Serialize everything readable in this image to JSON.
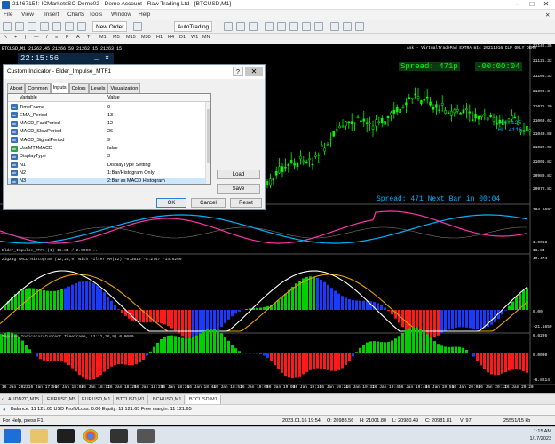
{
  "window": {
    "title": "21467154: ICMarketsSC-Demo02 - Demo Account - Raw Trading Ltd - [BTCUSD,M1]",
    "controls": [
      "–",
      "□",
      "✕"
    ]
  },
  "menu": [
    "File",
    "View",
    "Insert",
    "Charts",
    "Tools",
    "Window",
    "Help"
  ],
  "toolbar": {
    "new_order": "New Order",
    "autotrading": "AutoTrading",
    "timeframes": [
      "M1",
      "M5",
      "M15",
      "M30",
      "H1",
      "H4",
      "D1",
      "W1",
      "MN"
    ]
  },
  "chart": {
    "header": "BTCUSD,M1  21262.45 21266.59 21262.15 21263.15",
    "broker_label": "Ask - VirtualTradePad EXTRA mt4 20211016 CLP ONLY DEMO",
    "clock": "22:15:56",
    "spread_label": "Spread: 471p",
    "timer_label": "-00:00:04",
    "oc_label": "OC 125",
    "hl_label": "HL 4116",
    "bottom_info": "Spread: 471 Next Bar in 00:04",
    "price_axis": [
      "21142.35",
      "21125.33",
      "21106.33",
      "21090.3",
      "21075.30",
      "21060.63",
      "21040.88",
      "21022.03",
      "21006.83",
      "20989.83",
      "20972.83"
    ],
    "impulse_axis": [
      "104.6697",
      "1.9063",
      "16.84"
    ],
    "macd_axis": [
      "40.474",
      "0.00",
      "-21.1659"
    ],
    "impulse2_axis": [
      "6.6205",
      "0.0000",
      "-6.8214"
    ],
    "sub_titles": {
      "sub1": "Elder_Impulse_MTF1 (1) 16.84 / 2.5000 ...",
      "sub2": "ZigZag MACD Histogram (12,26,9) With Filter MA(12) -6.3519 -8.2747 -14.6266",
      "sub3": "Impulse Indicator(Current Timeframe, 13:12,26,9) 0.0000"
    },
    "time_axis": [
      "16 Jan 2023",
      "16 Jan 17:56",
      "16 Jan 18:04",
      "16 Jan 18:12",
      "16 Jan 18:20",
      "16 Jan 18:28",
      "16 Jan 18:36",
      "16 Jan 18:44",
      "16 Jan 18:52",
      "16 Jan 19:00",
      "16 Jan 19:08",
      "16 Jan 19:16",
      "16 Jan 19:24",
      "16 Jan 19:32",
      "16 Jan 19:40",
      "16 Jan 19:48",
      "16 Jan 19:56",
      "16 Jan 20:04",
      "16 Jan 20:12",
      "16 Jan 20:20"
    ]
  },
  "dialog": {
    "title": "Custom Indicator - Elder_Impulse_MTF1",
    "help": "?",
    "close": "✕",
    "tabs": [
      "About",
      "Common",
      "Inputs",
      "Colors",
      "Levels",
      "Visualization"
    ],
    "columns": [
      "Variable",
      "Value"
    ],
    "rows": [
      {
        "icon": "ab",
        "name": "TimeFrame",
        "value": "0"
      },
      {
        "icon": "ab",
        "name": "EMA_Period",
        "value": "13"
      },
      {
        "icon": "ab",
        "name": "MACD_FastPeriod",
        "value": "12"
      },
      {
        "icon": "ab",
        "name": "MACD_SlowPeriod",
        "value": "26"
      },
      {
        "icon": "ab",
        "name": "MACD_SignalPeriod",
        "value": "9"
      },
      {
        "icon": "ab",
        "name": "UseMT4MACD",
        "value": "false"
      },
      {
        "icon": "ab",
        "name": "DisplayType",
        "value": "3"
      },
      {
        "icon": "ab",
        "name": "N1",
        "value": "DisplayType Setting"
      },
      {
        "icon": "ab",
        "name": "N2",
        "value": "1:Bar/Histogram Only"
      },
      {
        "icon": "ab",
        "name": "N3",
        "value": "2:Bar as MACD Histogram"
      }
    ],
    "buttons": {
      "load": "Load",
      "save": "Save",
      "ok": "OK",
      "cancel": "Cancel",
      "reset": "Reset"
    }
  },
  "chart_tabs": [
    "AUDNZD,M15",
    "EURUSD,M5",
    "EURUSD,M1",
    "BTCUSD,M1",
    "BCHUSD,M1",
    "BTCUSD,M1"
  ],
  "terminal": {
    "line": "Balance: 11 121.65 USD  Profit/Loss: 0.00  Equity: 11 121.65  Free margin: 11 121.65"
  },
  "status": {
    "help": "For Help, press F1",
    "datetime": "2023.01.16 19:54",
    "open": "O: 20988.56",
    "high": "H: 21001.80",
    "low": "L: 20980.49",
    "close": "C: 20981.81",
    "volume": "V: 97",
    "traffic": "25551/15 kb"
  },
  "taskbar": {
    "time": "1:15 AM",
    "date": "1/17/2023"
  },
  "colors": {
    "bull": "#00d000",
    "bear": "#ff1a1a",
    "neutral": "#1a3aff",
    "cyan": "#00b4ff",
    "magenta": "#ff33aa",
    "macd_fast": "#ffffff",
    "macd_slow": "#e6a100",
    "overlay_green": "#00ff00"
  }
}
